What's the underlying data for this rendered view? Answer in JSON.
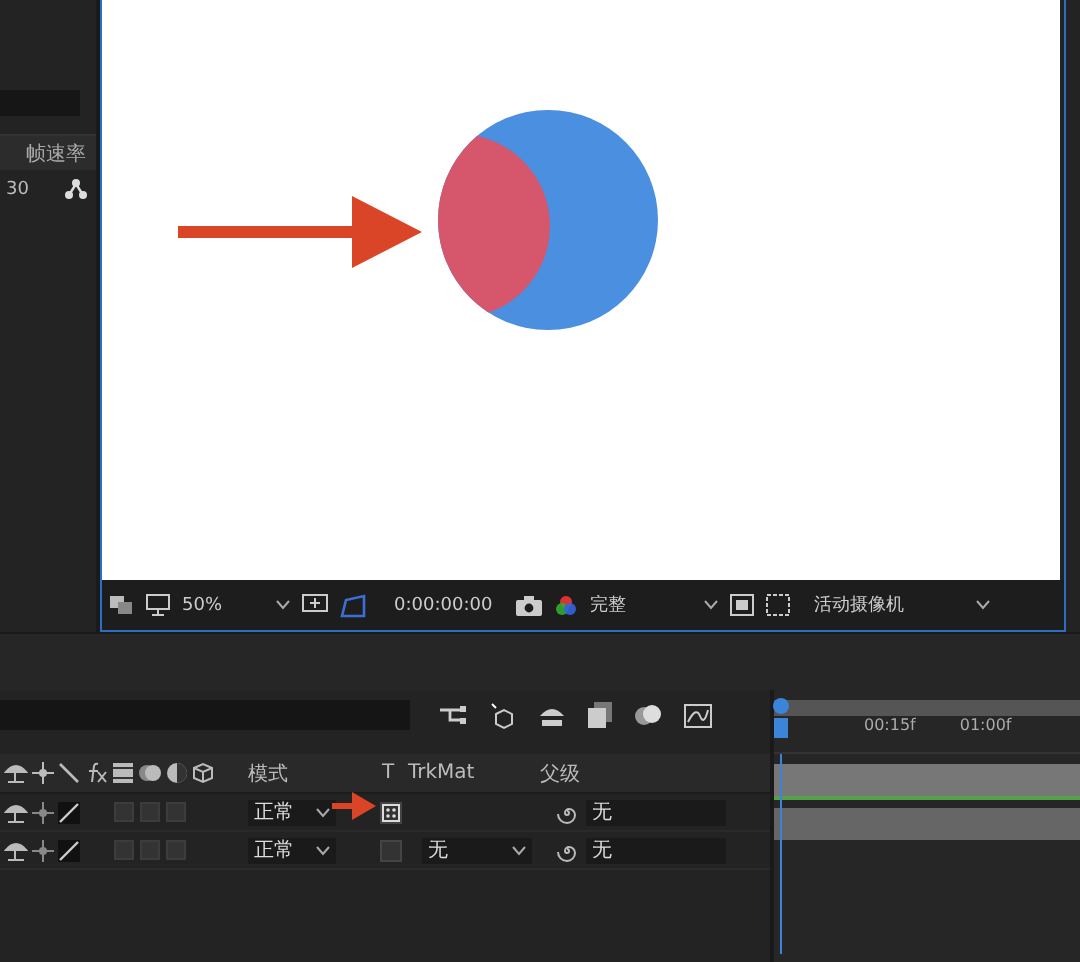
{
  "project_panel": {
    "column_header": "帧速率",
    "rows": [
      {
        "frame_rate": "30"
      }
    ]
  },
  "viewer": {
    "toolbar": {
      "zoom": "50%",
      "timecode": "0:00:00:00",
      "resolution": "完整",
      "camera": "活动摄像机"
    }
  },
  "timeline": {
    "ruler": [
      "00:15f",
      "01:00f"
    ],
    "columns": {
      "mode": "模式",
      "t": "T",
      "trkmat": "TrkMat",
      "parent": "父级"
    },
    "layers": [
      {
        "mode": "正常",
        "preserve_transparency": true,
        "parent": "无"
      },
      {
        "mode": "正常",
        "preserve_transparency": false,
        "trkmat": "无",
        "parent": "无"
      }
    ]
  }
}
